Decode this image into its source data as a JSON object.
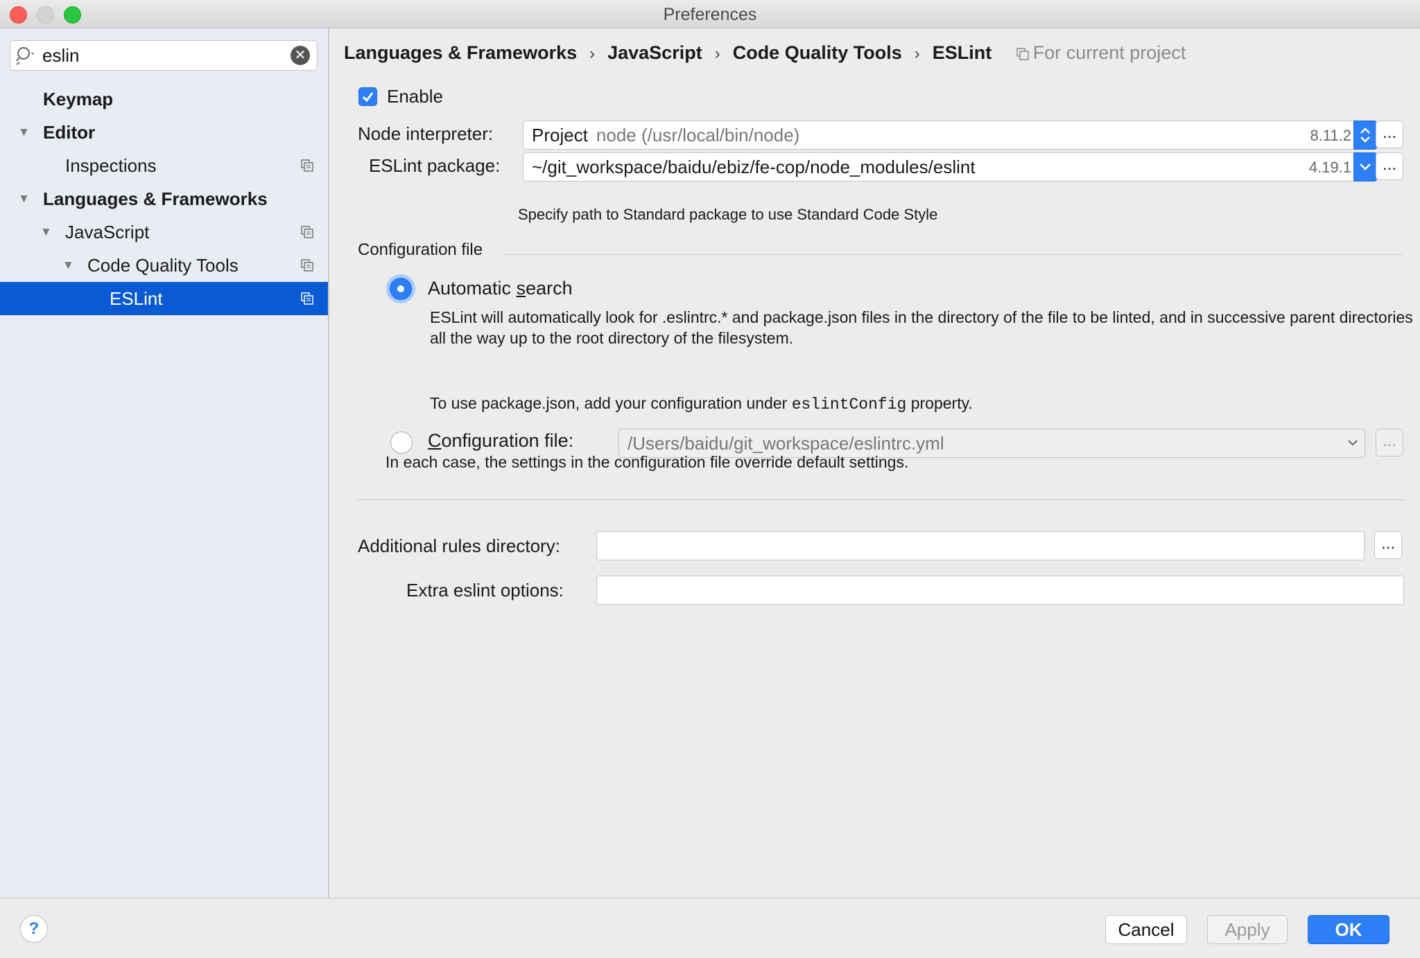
{
  "window": {
    "title": "Preferences"
  },
  "search": {
    "value": "eslin"
  },
  "sidebar": {
    "items": [
      {
        "label": "Keymap"
      },
      {
        "label": "Editor"
      },
      {
        "label": "Inspections"
      },
      {
        "label": "Languages & Frameworks"
      },
      {
        "label": "JavaScript"
      },
      {
        "label": "Code Quality Tools"
      },
      {
        "label": "ESLint"
      }
    ]
  },
  "breadcrumb": {
    "items": [
      "Languages & Frameworks",
      "JavaScript",
      "Code Quality Tools",
      "ESLint"
    ],
    "separator": "›",
    "scope": "For current project"
  },
  "form": {
    "enable_label": "Enable",
    "node_interpreter": {
      "label": "Node interpreter:",
      "prefix": "Project",
      "value": "node (/usr/local/bin/node)",
      "version": "8.11.2"
    },
    "eslint_package": {
      "label": "ESLint package:",
      "value": "~/git_workspace/baidu/ebiz/fe-cop/node_modules/eslint",
      "version": "4.19.1"
    },
    "hint": "Specify path to Standard package to use Standard Code Style",
    "config_group_title": "Configuration file",
    "auto_search": {
      "label_pre": "Automatic ",
      "label_mnemonic": "s",
      "label_post": "earch",
      "desc": "ESLint will automatically look for .eslintrc.* and package.json files in the directory of the file to be linted, and in successive parent directories all the way up to the root directory of the filesystem.",
      "desc2_pre": "To use package.json, add your configuration under ",
      "desc2_code": "eslintConfig",
      "desc2_post": " property."
    },
    "config_file": {
      "label_mnemonic": "C",
      "label_post": "onfiguration file:",
      "value": "/Users/baidu/git_workspace/eslintrc.yml"
    },
    "note": "In each case, the settings in the configuration file override default settings.",
    "additional_rules": {
      "label": "Additional rules directory:",
      "value": ""
    },
    "extra_options": {
      "label": "Extra eslint options:",
      "value": ""
    },
    "browse_label": "..."
  },
  "footer": {
    "help_label": "?",
    "cancel_label": "Cancel",
    "apply_label": "Apply",
    "ok_label": "OK"
  }
}
